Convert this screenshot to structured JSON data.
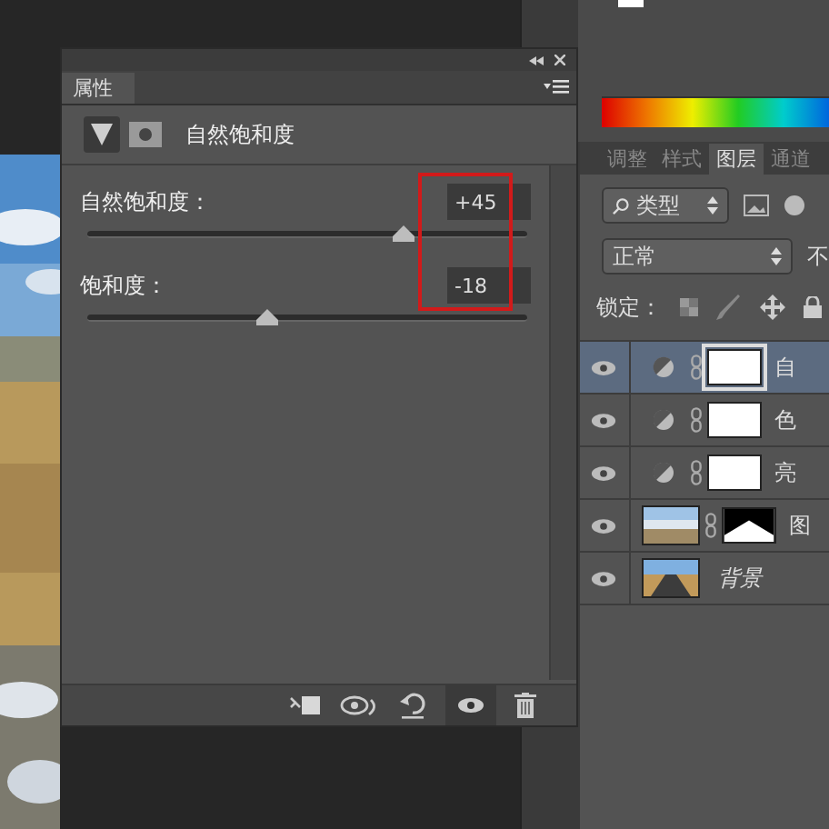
{
  "properties_panel": {
    "tab": "属性",
    "adjustment_title": "自然饱和度",
    "values_highlighted": true,
    "sliders": [
      {
        "label": "自然饱和度：",
        "value": "+45",
        "level": 0.72
      },
      {
        "label": "饱和度：",
        "value": "-18",
        "level": 0.41
      }
    ]
  },
  "layers_panel": {
    "tabs": [
      {
        "label": "调整",
        "selected": false
      },
      {
        "label": "样式",
        "selected": false
      },
      {
        "label": "图层",
        "selected": true
      },
      {
        "label": "通道",
        "selected": false
      }
    ],
    "filter": "类型",
    "blend_mode": "正常",
    "opacity_label": "不",
    "lock_label": "锁定：",
    "layers": [
      {
        "name": "自",
        "kind": "adjustment",
        "selected": true,
        "visible": true
      },
      {
        "name": "色",
        "kind": "adjustment",
        "selected": false,
        "visible": true
      },
      {
        "name": "亮",
        "kind": "adjustment",
        "selected": false,
        "visible": true
      },
      {
        "name": "图",
        "kind": "masked_image",
        "selected": false,
        "visible": true
      },
      {
        "name": "背景",
        "kind": "background",
        "selected": false,
        "visible": true
      }
    ]
  }
}
